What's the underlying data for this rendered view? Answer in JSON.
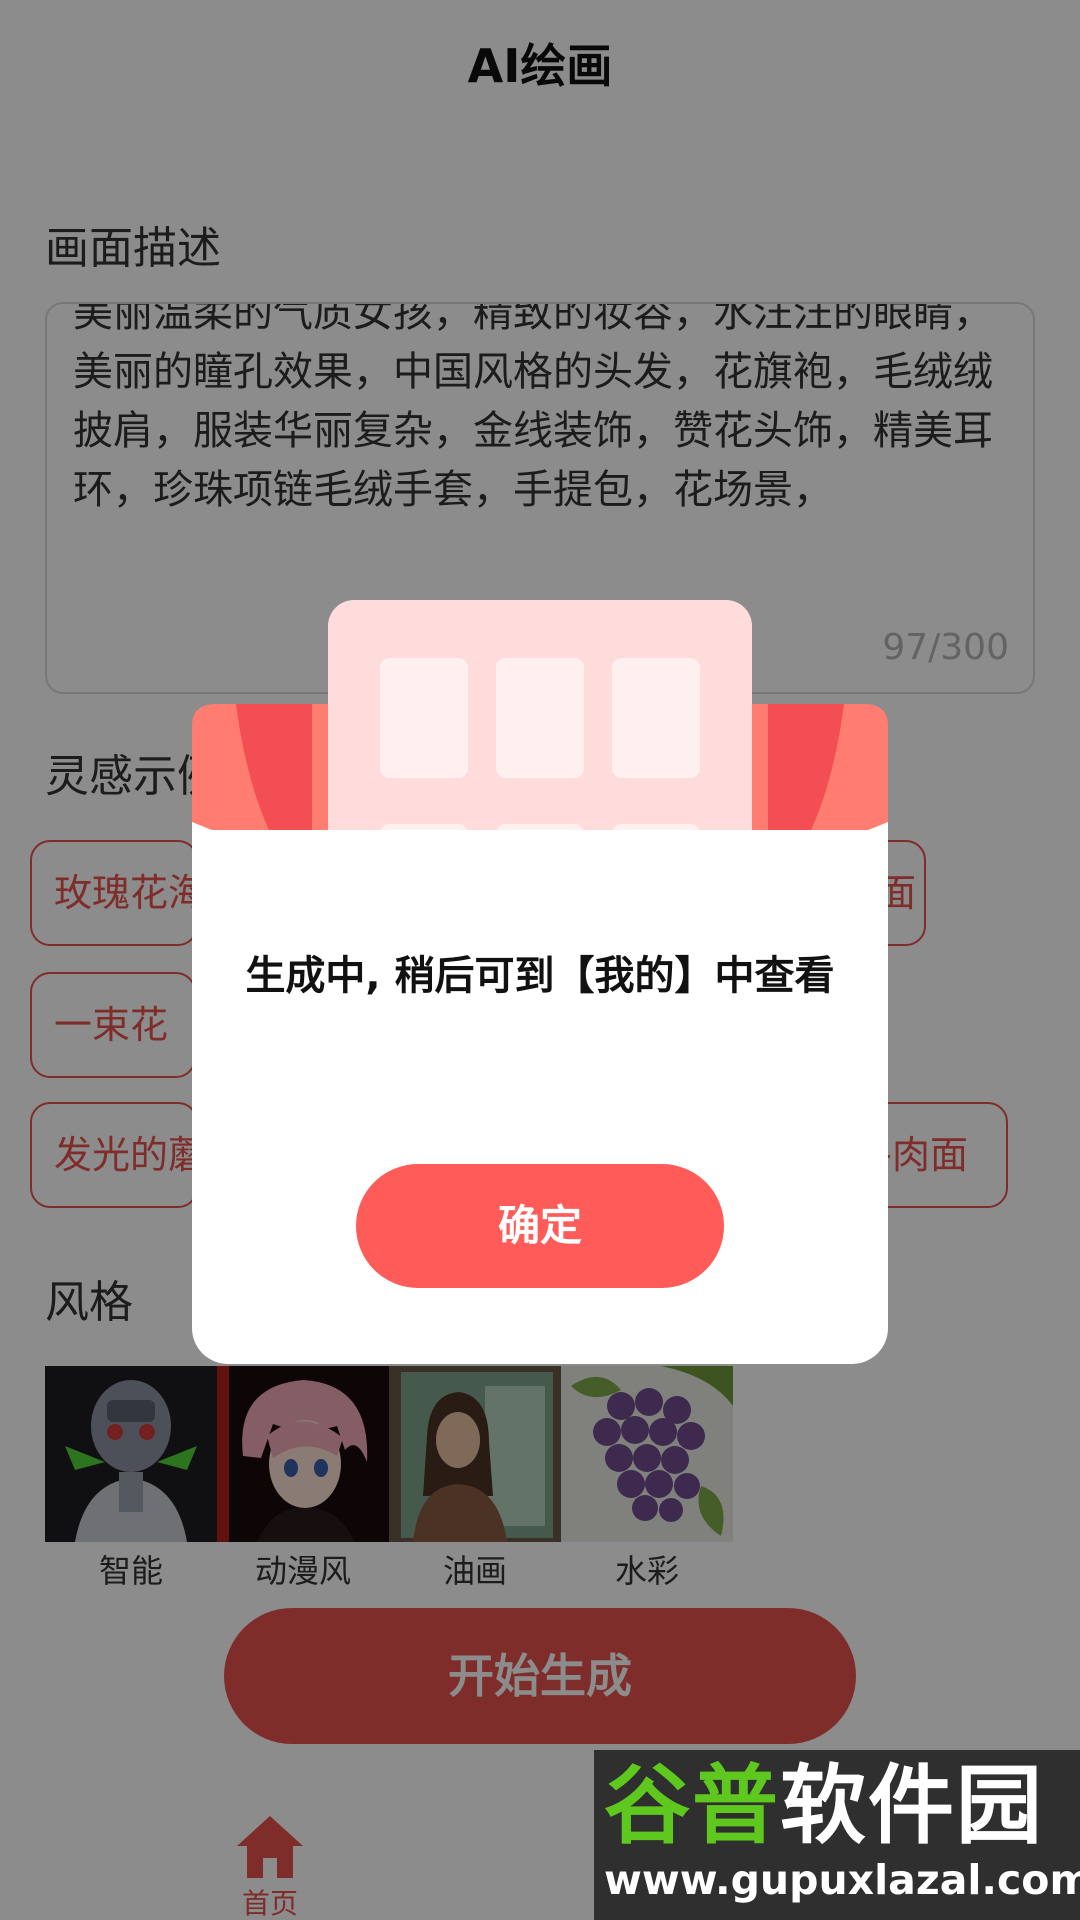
{
  "header": {
    "title": "AI绘画"
  },
  "description": {
    "label": "画面描述",
    "text": "美丽温柔的气质女孩，精致的妆容，水汪汪的眼睛，美丽的瞳孔效果，中国风格的头发，花旗袍，毛绒绒披肩，服装华丽复杂，金线装饰，赞花头饰，精美耳环，珍珠项链毛绒手套，手提包，花场景，",
    "count": "97/300"
  },
  "inspiration": {
    "label": "灵感示例",
    "chips": [
      "玫瑰花海",
      "面",
      "一束花",
      "发光的蘑",
      "牛肉面"
    ]
  },
  "styles": {
    "label": "风格",
    "items": [
      {
        "label": "智能",
        "icon": "robot-thumbnail"
      },
      {
        "label": "动漫风",
        "icon": "anime-girl-thumbnail"
      },
      {
        "label": "油画",
        "icon": "oil-portrait-thumbnail"
      },
      {
        "label": "水彩",
        "icon": "watercolor-grapes-thumbnail"
      }
    ]
  },
  "start_button": {
    "label": "开始生成"
  },
  "tabbar": {
    "home_label": "首页",
    "home_icon": "home-icon"
  },
  "watermark": {
    "brand_part1": "谷普",
    "brand_part2": "软件园",
    "url": "www.gupuxlazal.com"
  },
  "modal": {
    "message": "生成中, 稍后可到【我的】中查看",
    "confirm_label": "确定"
  },
  "colors": {
    "accent": "#e8534f",
    "modal_button": "#ff5b58",
    "modal_art_pink": "#ffdcdc",
    "modal_art_red": "#f24e54"
  }
}
